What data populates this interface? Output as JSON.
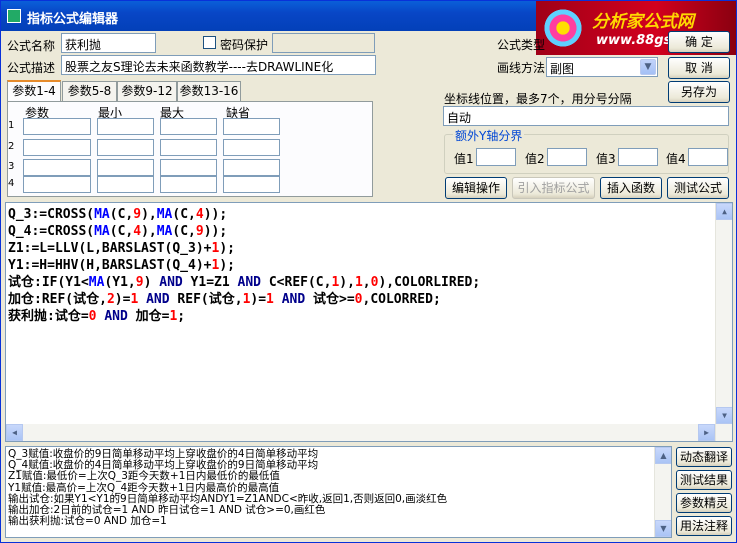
{
  "window": {
    "title": "指标公式编辑器"
  },
  "logo": {
    "line1": "分析家公式网",
    "line2": "www.88gs.com"
  },
  "form": {
    "name_label": "公式名称",
    "name_value": "获利抛",
    "password_label": "密码保护",
    "type_label": "公式类型",
    "desc_label": "公式描述",
    "desc_value": "股票之友S理论去未来函数教学----去DRAWLINE化",
    "draw_method_label": "画线方法",
    "draw_method_value": "副图",
    "ok_button": "确 定",
    "cancel_button": "取 消",
    "saveas_button": "另存为"
  },
  "tabs": [
    "参数1-4",
    "参数5-8",
    "参数9-12",
    "参数13-16"
  ],
  "params": {
    "headers": [
      "参数",
      "最小",
      "最大",
      "缺省"
    ],
    "rows": [
      "1",
      "2",
      "3",
      "4"
    ]
  },
  "coord": {
    "label": "坐标线位置，最多7个，用分号分隔",
    "value": "自动"
  },
  "extra_y": {
    "legend": "额外Y轴分界",
    "labels": [
      "值1",
      "值2",
      "值3",
      "值4"
    ]
  },
  "actions": [
    "编辑操作",
    "引入指标公式",
    "插入函数",
    "测试公式"
  ],
  "code_lines": [
    [
      [
        "Q_3:=CROSS(",
        "t"
      ],
      [
        "MA",
        "f"
      ],
      [
        "(C,",
        "t"
      ],
      [
        "9",
        "n"
      ],
      [
        "),",
        "t"
      ],
      [
        "MA",
        "f"
      ],
      [
        "(C,",
        "t"
      ],
      [
        "4",
        "n"
      ],
      [
        "));",
        "t"
      ]
    ],
    [
      [
        "Q_4:=CROSS(",
        "t"
      ],
      [
        "MA",
        "f"
      ],
      [
        "(C,",
        "t"
      ],
      [
        "4",
        "n"
      ],
      [
        "),",
        "t"
      ],
      [
        "MA",
        "f"
      ],
      [
        "(C,",
        "t"
      ],
      [
        "9",
        "n"
      ],
      [
        "));",
        "t"
      ]
    ],
    [
      [
        "Z1:=L=LLV(L,BARSLAST(Q_3)+",
        "t"
      ],
      [
        "1",
        "n"
      ],
      [
        ");",
        "t"
      ]
    ],
    [
      [
        "Y1:=H=HHV(H,BARSLAST(Q_4)+",
        "t"
      ],
      [
        "1",
        "n"
      ],
      [
        ");",
        "t"
      ]
    ],
    [
      [
        "试仓:IF(Y1<",
        "t"
      ],
      [
        "MA",
        "f"
      ],
      [
        "(Y1,",
        "t"
      ],
      [
        "9",
        "n"
      ],
      [
        ") ",
        "t"
      ],
      [
        "AND",
        "k"
      ],
      [
        " Y1=Z1 ",
        "t"
      ],
      [
        "AND",
        "k"
      ],
      [
        " C<REF(C,",
        "t"
      ],
      [
        "1",
        "n"
      ],
      [
        "),",
        "t"
      ],
      [
        "1",
        "n"
      ],
      [
        ",",
        "t"
      ],
      [
        "0",
        "n"
      ],
      [
        "),COLORLIRED;",
        "t"
      ]
    ],
    [
      [
        "加仓:REF(试仓,",
        "t"
      ],
      [
        "2",
        "n"
      ],
      [
        ")=",
        "t"
      ],
      [
        "1",
        "n"
      ],
      [
        "  ",
        "t"
      ],
      [
        "AND",
        "k"
      ],
      [
        " REF(试仓,",
        "t"
      ],
      [
        "1",
        "n"
      ],
      [
        ")=",
        "t"
      ],
      [
        "1",
        "n"
      ],
      [
        " ",
        "t"
      ],
      [
        "AND",
        "k"
      ],
      [
        " 试仓>=",
        "t"
      ],
      [
        "0",
        "n"
      ],
      [
        ",COLORRED;",
        "t"
      ]
    ],
    [
      [
        "获利抛:试仓=",
        "t"
      ],
      [
        "0",
        "n"
      ],
      [
        " ",
        "t"
      ],
      [
        "AND",
        "k"
      ],
      [
        " 加仓=",
        "t"
      ],
      [
        "1",
        "n"
      ],
      [
        ";",
        "t"
      ]
    ]
  ],
  "desc_lines": [
    "Q_3赋值:收盘价的9日简单移动平均上穿收盘价的4日简单移动平均",
    "Q_4赋值:收盘价的4日简单移动平均上穿收盘价的9日简单移动平均",
    "Z1赋值:最低价=上次Q_3距今天数+1日内最低价的最低值",
    "Y1赋值:最高价=上次Q_4距今天数+1日内最高价的最高值",
    "输出试仓:如果Y1<Y1的9日简单移动平均ANDY1=Z1ANDC<昨收,返回1,否则返回0,画淡红色",
    "输出加仓:2日前的试仓=1  AND 昨日试仓=1 AND 试仓>=0,画红色",
    "输出获利抛:试仓=0 AND 加仓=1"
  ],
  "side_buttons": [
    "动态翻译",
    "测试结果",
    "参数精灵",
    "用法注释"
  ]
}
